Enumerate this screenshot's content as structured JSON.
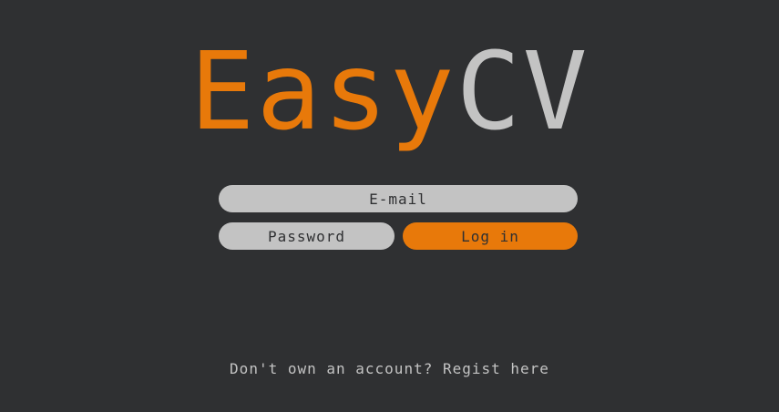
{
  "logo": {
    "part_a": "Easy",
    "part_b": "CV",
    "color_a": "#e8790a",
    "color_b": "#c3c3c3"
  },
  "login_form": {
    "email_placeholder": "E-mail",
    "email_value": "",
    "password_placeholder": "Password",
    "password_value": "",
    "login_label": "Log in"
  },
  "footer": {
    "prompt": "Don't own an account? ",
    "register_link": "Regist here"
  },
  "colors": {
    "background": "#2f3032",
    "accent": "#e8790a",
    "input": "#c3c3c3"
  }
}
